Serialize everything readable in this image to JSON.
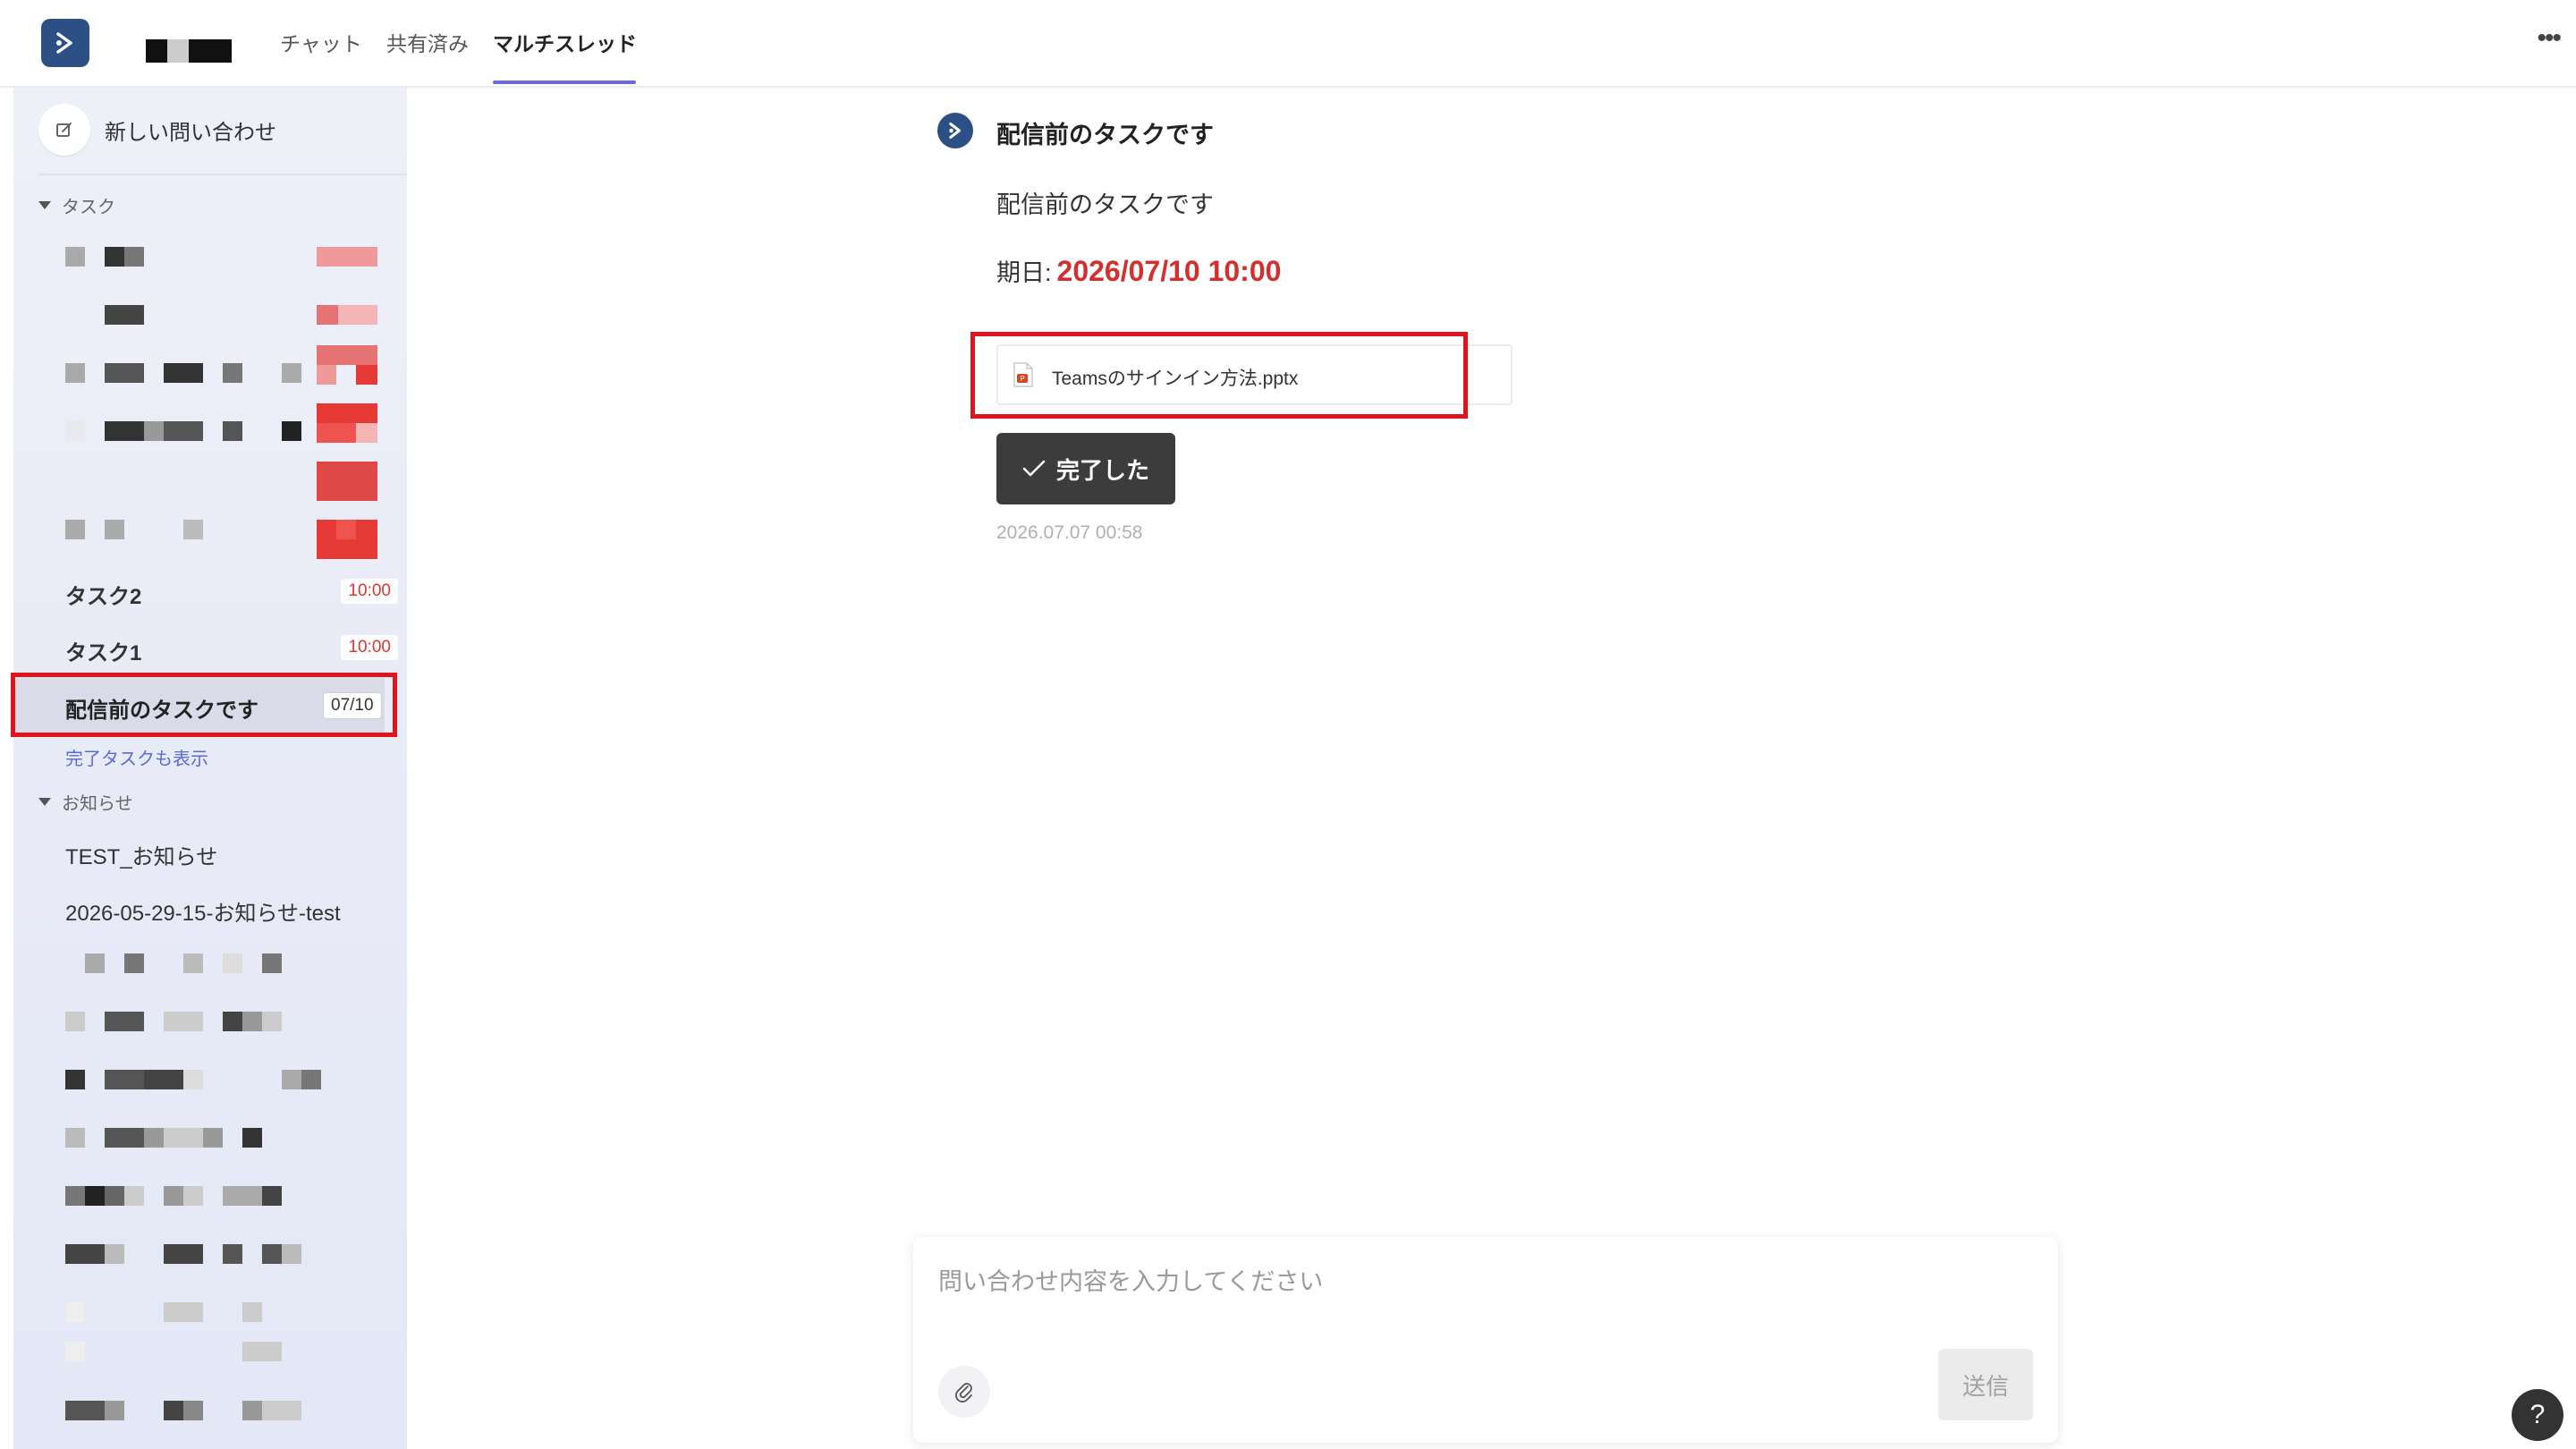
{
  "header": {
    "tabs": [
      {
        "label": "チャット"
      },
      {
        "label": "共有済み"
      },
      {
        "label": "マルチスレッド",
        "active": true
      }
    ],
    "more_label": "•••",
    "accent_color": "#6b6bd6",
    "brand_color": "#2c4f86"
  },
  "sidebar": {
    "new_inquiry_label": "新しい問い合わせ",
    "tasks_section_label": "タスク",
    "tasks": [
      {
        "title": "タスク2",
        "badge": "10:00"
      },
      {
        "title": "タスク1",
        "badge": "10:00"
      },
      {
        "title": "配信前のタスクです",
        "badge": "07/10",
        "selected": true
      }
    ],
    "show_completed_label": "完了タスクも表示",
    "notices_section_label": "お知らせ",
    "notices": [
      {
        "title": "TEST_お知らせ"
      },
      {
        "title": "2026-05-29-15-お知らせ-test"
      }
    ]
  },
  "message": {
    "title": "配信前のタスクです",
    "body": "配信前のタスクです",
    "due_label": "期日:",
    "due_value": "2026/07/10 10:00",
    "attachment_name": "Teamsのサインイン方法.pptx",
    "complete_button_label": "完了した",
    "timestamp": "2026.07.07 00:58"
  },
  "composer": {
    "placeholder": "問い合わせ内容を入力してください",
    "send_label": "送信"
  },
  "help_label": "?"
}
